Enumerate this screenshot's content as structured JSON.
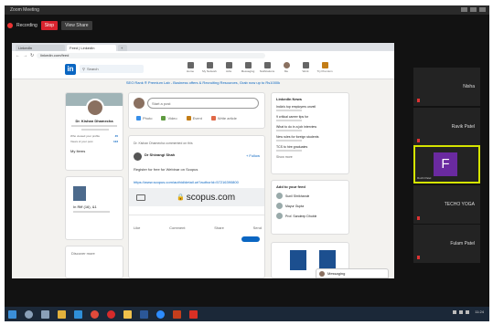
{
  "zoom": {
    "window_title": "Zoom Meeting",
    "recording_label": "Recording",
    "stop_label": "Stop",
    "view_label": "View Share",
    "participants": [
      {
        "name": "Nisha",
        "active": false
      },
      {
        "name": "Ravik Patel",
        "active": false
      },
      {
        "name": "",
        "initial": "F",
        "sub": "Ruchi Patel",
        "active": true
      },
      {
        "name": "TECHO YOGA",
        "active": false
      },
      {
        "name": "Fulam Patel",
        "active": false
      }
    ]
  },
  "browser": {
    "tabs": [
      "LinkedIn",
      "Feed | LinkedIn",
      "+"
    ],
    "url": "linkedin.com/feed",
    "nav_icons": [
      "back-icon",
      "forward-icon",
      "reload-icon",
      "home-icon"
    ]
  },
  "linkedin": {
    "logo": "in",
    "search_placeholder": "Search",
    "nav": [
      "Home",
      "My Network",
      "Jobs",
      "Messaging",
      "Notifications",
      "Me",
      "Work",
      "Try Premium"
    ],
    "promo": "SEO Rank ® Premium Lab - Business offers & Recruiting Resources, Grab now up to Rs1000k",
    "profile": {
      "name": "Dr. Kishan Dhamecha",
      "stats": [
        {
          "label": "Who viewed your profile",
          "value": "45"
        },
        {
          "label": "Views of your post",
          "value": "123"
        }
      ],
      "my_items": "My Items",
      "recent_title": "In Riff (16), &1",
      "discover": "Discover more"
    },
    "composer": {
      "placeholder": "Start a post",
      "actions": [
        {
          "label": "Photo",
          "color": "#378fe9"
        },
        {
          "label": "Video",
          "color": "#5f9b41"
        },
        {
          "label": "Event",
          "color": "#c37d16"
        },
        {
          "label": "Write article",
          "color": "#e06847"
        }
      ]
    },
    "post": {
      "header": "Dr. Kishan Dhamecha commented on this",
      "author": "Dr Shivangi Shah",
      "follow": "+ Follow",
      "text": "Register for free for Webinar on Scopus",
      "link": "https://www.scopus.com/authid/detail.uri?authorId=57216390800",
      "domain": "scopus.com",
      "reactions": [
        "Like",
        "Comment",
        "Share",
        "Send"
      ]
    },
    "news": {
      "title": "LinkedIn News",
      "items": [
        "India's top employers unveil",
        "9 critical career tips for",
        "What to do in a job interview",
        "New rules for foreign students",
        "TCS to hire graduates"
      ],
      "show_more": "Show more"
    },
    "add_feed": {
      "title": "Add to your feed",
      "items": [
        "Sunil Shrikhande",
        "Mayur Gupta",
        "Prof. Sandeep Dhoble"
      ]
    },
    "messaging": "Messaging"
  },
  "taskbar": {
    "icons": [
      {
        "name": "start-icon",
        "color": "#3b8fd9"
      },
      {
        "name": "search-icon",
        "color": "#8aa0b8"
      },
      {
        "name": "task-view-icon",
        "color": "#8aa0b8"
      },
      {
        "name": "file-explorer-icon",
        "color": "#e2b13c"
      },
      {
        "name": "edge-icon",
        "color": "#2f8fd8"
      },
      {
        "name": "chrome-icon",
        "color": "#e04a3b"
      },
      {
        "name": "opera-icon",
        "color": "#d62b2b"
      },
      {
        "name": "explorer-icon",
        "color": "#f0c14b"
      },
      {
        "name": "word-icon",
        "color": "#2b5797"
      },
      {
        "name": "zoom-icon",
        "color": "#2d8cff"
      },
      {
        "name": "powerpoint-icon",
        "color": "#c43e1c"
      },
      {
        "name": "pdf-icon",
        "color": "#d93025"
      }
    ],
    "clock": "11:24"
  }
}
